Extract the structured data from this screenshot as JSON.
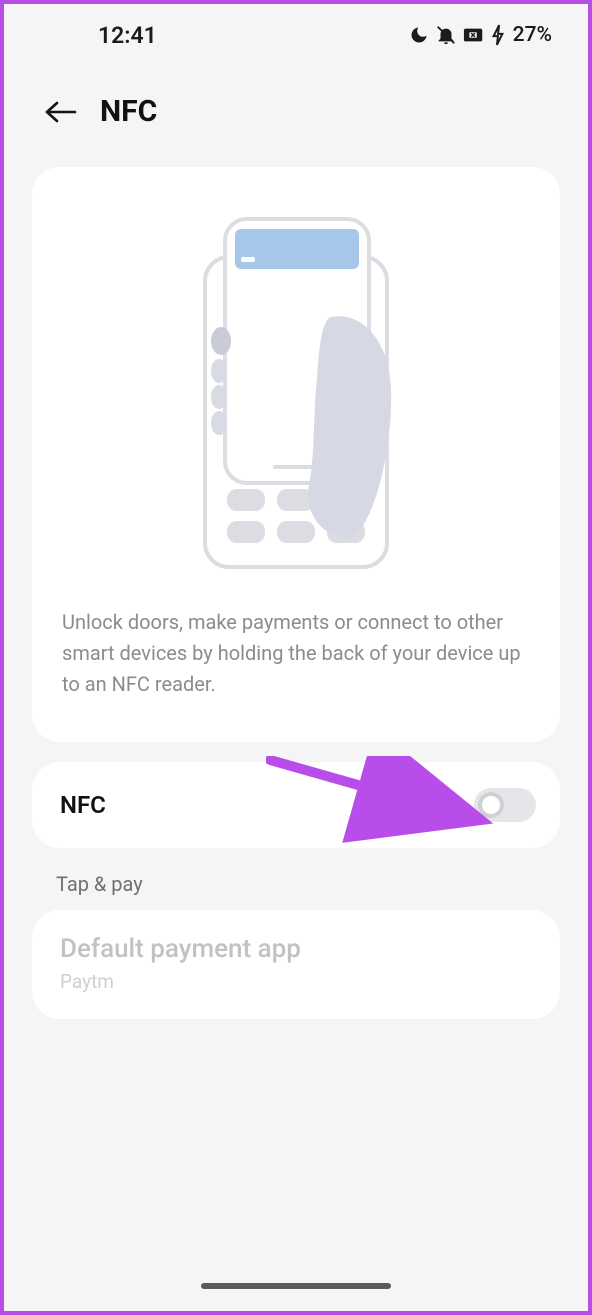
{
  "status": {
    "time": "12:41",
    "battery_pct": "27%"
  },
  "header": {
    "title": "NFC"
  },
  "hero": {
    "description": "Unlock doors, make payments or connect to other smart devices by holding the back of your device up to an NFC reader."
  },
  "nfc_toggle": {
    "label": "NFC",
    "enabled": false
  },
  "tap_pay": {
    "section": "Tap & pay",
    "title": "Default payment app",
    "value": "Paytm"
  }
}
